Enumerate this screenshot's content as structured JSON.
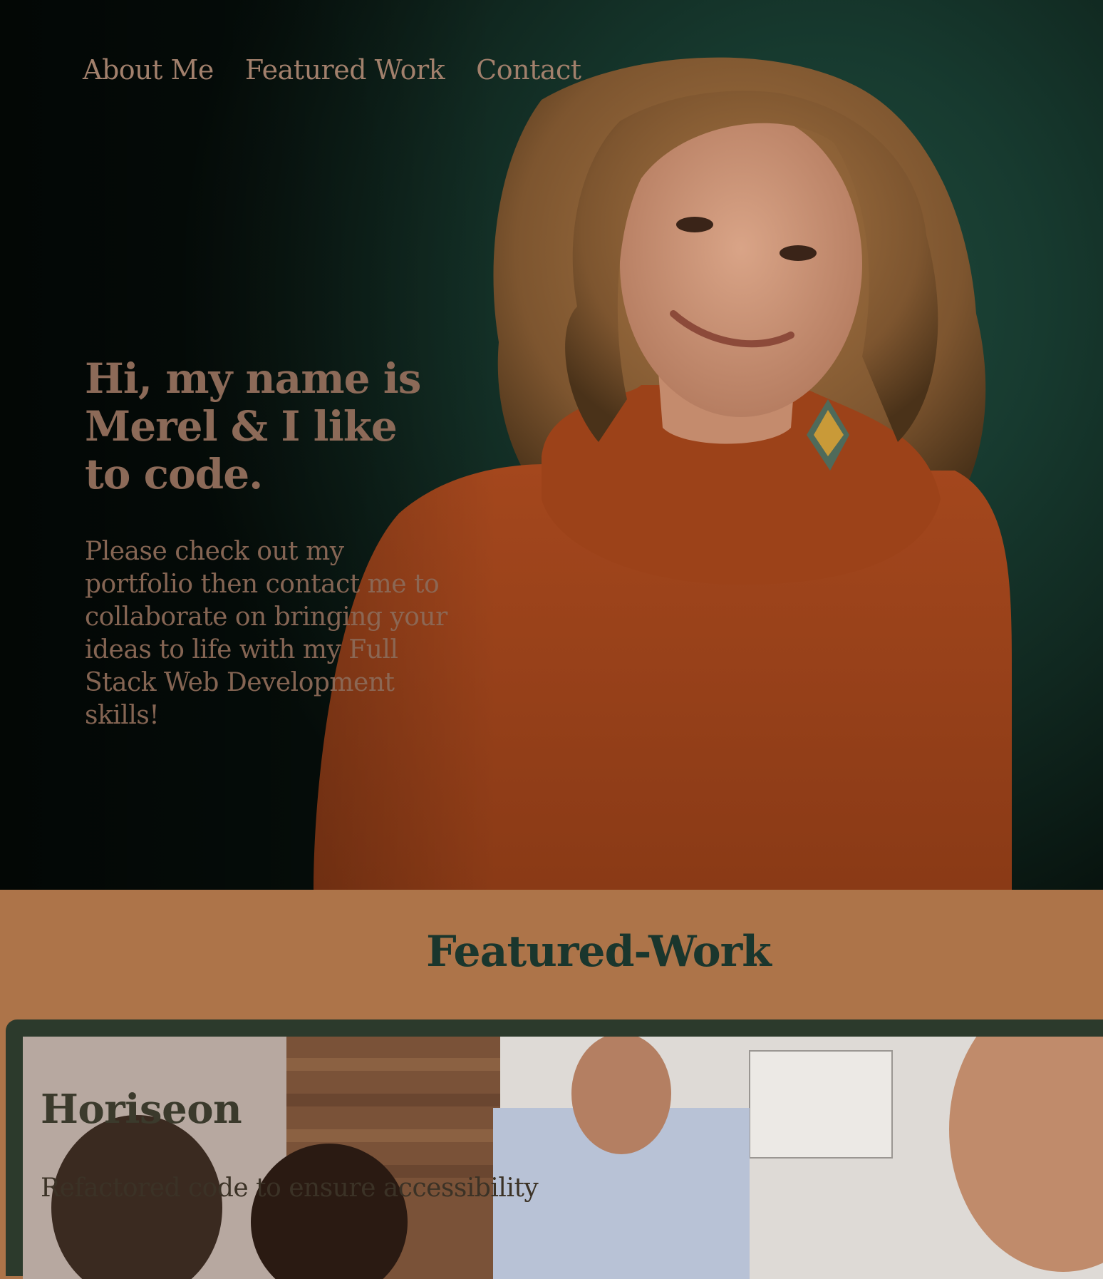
{
  "nav": {
    "items": [
      {
        "label": "About Me"
      },
      {
        "label": "Featured Work"
      },
      {
        "label": "Contact"
      }
    ]
  },
  "hero": {
    "title": "Hi, my name is Merel & I like to code.",
    "subtitle": "Please check out my portfolio then contact me to collaborate on bringing your ideas to life with my Full Stack Web Development skills!"
  },
  "featured": {
    "heading": "Featured-Work",
    "projects": [
      {
        "title": "Horiseon",
        "description": "Refactored code to ensure accessibility"
      }
    ]
  },
  "colors": {
    "hero_bg": "#173a2f",
    "hero_text": "#8c6a58",
    "section_bg": "#ad7449",
    "heading_text": "#1a362d",
    "card_border": "#2c3a2c"
  }
}
